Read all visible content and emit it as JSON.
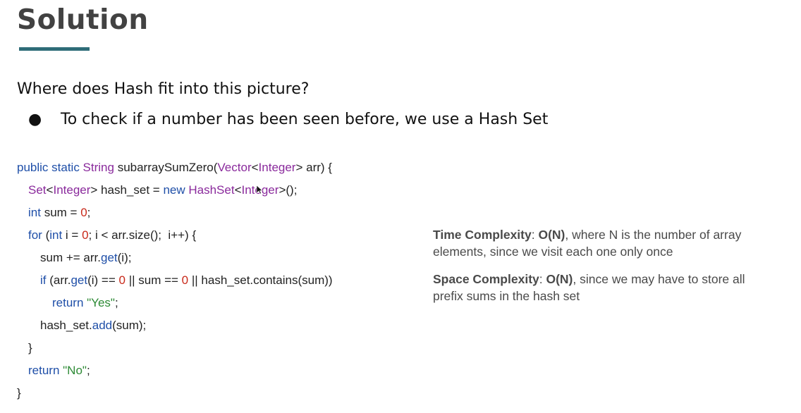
{
  "slide": {
    "title": "Solution",
    "question": "Where does Hash fit into this picture?",
    "bullet": "To check if a number has been seen before, we use a Hash Set"
  },
  "code": {
    "l1": {
      "a": "public static ",
      "b": "String",
      "c": " subarraySumZero(",
      "d": "Vector",
      "e": "<",
      "f": "Integer",
      "g": "> arr) {"
    },
    "l2": {
      "a": "Set",
      "b": "<",
      "c": "Integer",
      "d": "> hash_set = ",
      "e": "new ",
      "f": "HashSet",
      "g": "<",
      "h": "Integer",
      "i": ">();"
    },
    "l3": {
      "a": "int",
      " b": " sum = ",
      "c": "0",
      "d": ";"
    },
    "l4": {
      "a": "for",
      " b": " (",
      "c": "int",
      "d": " i = ",
      "e": "0",
      "f": "; i < arr.size();  i++) {"
    },
    "l5": {
      "a": "sum += arr.",
      "b": "get",
      "c": "(i);"
    },
    "l6": {
      "a": "if",
      " b": " (arr.",
      "c": "get",
      "d": "(i) == ",
      "e": "0",
      "f": " || sum == ",
      "g": "0",
      "h": " || hash_set.contains(sum))"
    },
    "l7": {
      "a": "return ",
      "b": "\"Yes\"",
      "c": ";"
    },
    "l8": {
      "a": "hash_set.",
      "b": "add",
      "c": "(sum);"
    },
    "l9": {
      "a": "}"
    },
    "l10": {
      "a": "return ",
      "b": "\"No\"",
      "c": ";"
    },
    "l11": {
      "a": "}"
    }
  },
  "complexity": {
    "time_label": "Time Complexity",
    "time_value": "O(N)",
    "time_text": ", where N is the number of array elements, since we visit each one only once",
    "space_label": "Space Complexity",
    "space_value": "O(N)",
    "space_text": ", since we may have to store all prefix sums in the hash set"
  },
  "colors": {
    "keyword": "#1f4fa8",
    "type": "#8a2a9c",
    "number": "#c8291a",
    "string": "#2d8a35",
    "accent_bar": "#2e6c78"
  }
}
